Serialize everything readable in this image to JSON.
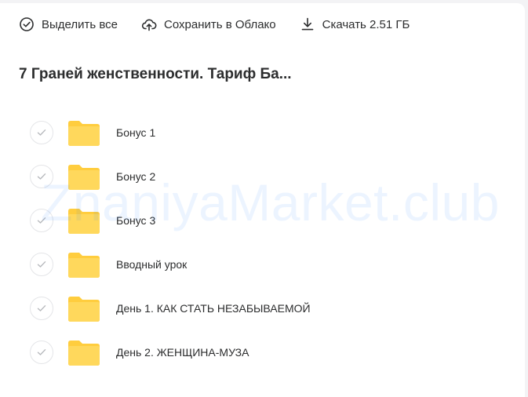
{
  "toolbar": {
    "select_all_label": "Выделить все",
    "save_cloud_label": "Сохранить в Облако",
    "download_label": "Скачать 2.51 ГБ"
  },
  "folder_title": "7 Граней женственности. Тариф Ба...",
  "items": [
    {
      "label": "Бонус 1"
    },
    {
      "label": "Бонус 2"
    },
    {
      "label": "Бонус 3"
    },
    {
      "label": "Вводный урок"
    },
    {
      "label": "День 1. КАК СТАТЬ НЕЗАБЫВАЕМОЙ"
    },
    {
      "label": "День 2. ЖЕНЩИНА-МУЗА"
    }
  ],
  "watermark_text": "ZnaniyaMarket.club",
  "colors": {
    "folder": "#ffd85c",
    "folder_tab": "#ffcd3e",
    "text": "#2c2d2e",
    "check_border": "#e4e5e8",
    "watermark": "#1e7bff"
  },
  "icons": {
    "select_all": "check-circle-icon",
    "save_cloud": "cloud-upload-icon",
    "download": "download-icon",
    "folder": "folder-icon",
    "checkbox": "checkmark-icon"
  }
}
